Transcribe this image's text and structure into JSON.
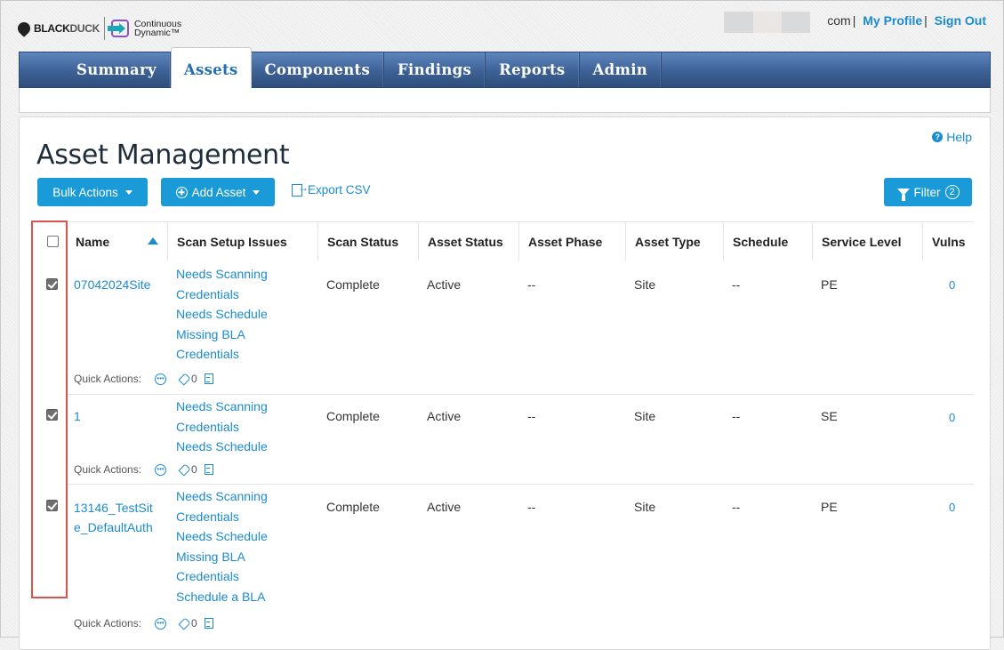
{
  "brand": {
    "blackduck_a": "BLACK",
    "blackduck_b": "DUCK",
    "cd_line1": "Continuous",
    "cd_line2": "Dynamic™"
  },
  "top_links": {
    "email_suffix": "com",
    "my_profile": "My Profile",
    "sign_out": "Sign Out",
    "separator": "|"
  },
  "nav": {
    "tabs": [
      "Summary",
      "Assets",
      "Components",
      "Findings",
      "Reports",
      "Admin"
    ],
    "active": "Assets"
  },
  "page": {
    "title": "Asset Management",
    "help": "Help",
    "bulk_actions": "Bulk Actions",
    "add_asset": "Add Asset",
    "export_csv": "Export CSV",
    "filter": "Filter",
    "filter_count": "2"
  },
  "table": {
    "headers": [
      "Name",
      "Scan Setup Issues",
      "Scan Status",
      "Asset Status",
      "Asset Phase",
      "Asset Type",
      "Schedule",
      "Service Level",
      "Vulns"
    ],
    "quick_actions_label": "Quick Actions:",
    "rows": [
      {
        "name_lines": [
          "07042024Site"
        ],
        "issues": [
          "Needs Scanning",
          "Credentials",
          "Needs Schedule",
          "Missing BLA",
          "Credentials"
        ],
        "scan_status": "Complete",
        "asset_status": "Active",
        "asset_phase": "--",
        "asset_type": "Site",
        "schedule": "--",
        "service_level": "PE",
        "vulns": "0",
        "tags": "0",
        "checked": true
      },
      {
        "name_lines": [
          "1"
        ],
        "issues": [
          "Needs Scanning",
          "Credentials",
          "Needs Schedule"
        ],
        "scan_status": "Complete",
        "asset_status": "Active",
        "asset_phase": "--",
        "asset_type": "Site",
        "schedule": "--",
        "service_level": "SE",
        "vulns": "0",
        "tags": "0",
        "checked": true
      },
      {
        "name_lines": [
          "13146_TestSit",
          "e_DefaultAuth"
        ],
        "issues": [
          "Needs Scanning",
          "Credentials",
          "Needs Schedule",
          "Missing BLA",
          "Credentials",
          "Schedule a BLA"
        ],
        "scan_status": "Complete",
        "asset_status": "Active",
        "asset_phase": "--",
        "asset_type": "Site",
        "schedule": "--",
        "service_level": "PE",
        "vulns": "0",
        "tags": "0",
        "checked": true
      }
    ]
  },
  "colors": {
    "accent": "#1a9ad6",
    "link": "#1b8bd0",
    "nav": "#3d6196",
    "highlight": "#d9534f"
  }
}
